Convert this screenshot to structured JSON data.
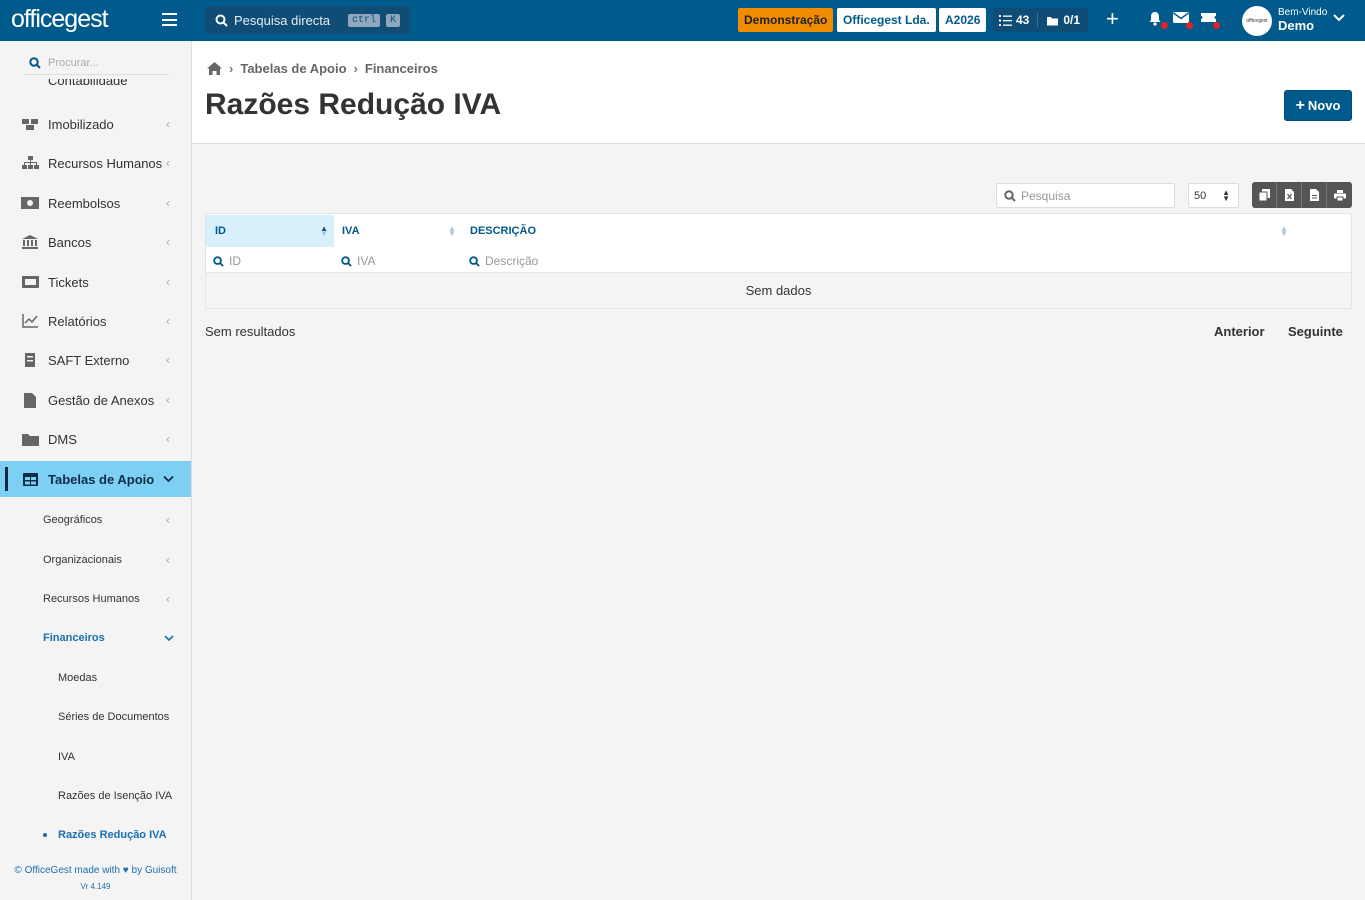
{
  "topbar": {
    "logo": "officegest",
    "search_placeholder": "Pesquisa directa",
    "kbd_ctrl": "ctrl",
    "kbd_k": "K",
    "badge_demo": "Demonstração",
    "badge_company": "Officegest Lda.",
    "badge_year": "A2026",
    "count_tasks": "43",
    "count_docs": "0/1",
    "avatar_text": "officegest",
    "welcome": "Bem-Vindo",
    "user": "Demo"
  },
  "sidebar": {
    "search_placeholder": "Procurar...",
    "cut_item": "Contabilidade",
    "items": [
      {
        "label": "Imobilizado",
        "icon": "boxes-icon"
      },
      {
        "label": "Recursos Humanos",
        "icon": "org-chart-icon"
      },
      {
        "label": "Reembolsos",
        "icon": "money-icon"
      },
      {
        "label": "Bancos",
        "icon": "bank-icon"
      },
      {
        "label": "Tickets",
        "icon": "ticket-icon"
      },
      {
        "label": "Relatórios",
        "icon": "chart-icon"
      },
      {
        "label": "SAFT Externo",
        "icon": "saft-icon"
      },
      {
        "label": "Gestão de Anexos",
        "icon": "file-icon"
      },
      {
        "label": "DMS",
        "icon": "folder-icon"
      },
      {
        "label": "Tabelas de Apoio",
        "icon": "table-icon"
      }
    ],
    "sub_items": [
      "Geográficos",
      "Organizacionais",
      "Recursos Humanos",
      "Financeiros"
    ],
    "sub2_items": [
      "Moedas",
      "Séries de Documentos",
      "IVA",
      "Razões de Isenção IVA",
      "Razões Redução IVA"
    ],
    "footer_line": "© OfficeGest made with ♥ by Guisoft",
    "version": "Vr 4.149"
  },
  "header": {
    "crumb_1": "Tabelas de Apoio",
    "crumb_2": "Financeiros",
    "title": "Razões Redução IVA",
    "novo_label": "Novo"
  },
  "table": {
    "search_placeholder": "Pesquisa",
    "page_size": "50",
    "columns": [
      "ID",
      "IVA",
      "DESCRIÇÃO"
    ],
    "filters": [
      "ID",
      "IVA",
      "Descrição"
    ],
    "empty": "Sem dados",
    "results": "Sem resultados",
    "prev": "Anterior",
    "next": "Seguinte"
  },
  "colors": {
    "primary": "#005a8c",
    "accent": "#7ecff4",
    "demo": "#f08c00"
  }
}
